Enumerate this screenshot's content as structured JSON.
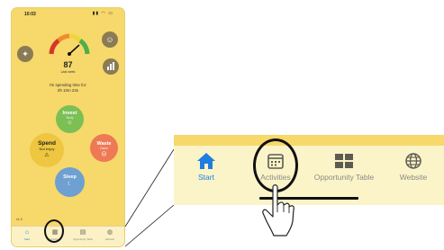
{
  "phone": {
    "status": {
      "time": "10:03",
      "icons": "▮▮ ◠ ▭"
    },
    "top_left_icon": "handshake-icon",
    "top_right_icon": "smiley-icon",
    "stats_icon": "bar-chart-icon",
    "score": "87",
    "score_label": "Last week",
    "spending_line1": "I'm spending time for:",
    "spending_line2": "0h 10m 23s",
    "bubbles": {
      "invest": {
        "title": "Invest",
        "sub": "Study",
        "icon": "☺"
      },
      "spend": {
        "title": "Spend",
        "sub": "Not enjoy",
        "icon": "⚠"
      },
      "waste": {
        "title": "Waste",
        "sub": "Game",
        "icon": "☹"
      },
      "sleep": {
        "title": "Sleep",
        "icon": "☾"
      }
    },
    "version": "v1.3",
    "tabs": [
      {
        "label": "Start",
        "icon": "⌂"
      },
      {
        "label": "Activities",
        "icon": "▦"
      },
      {
        "label": "Opportunity Table",
        "icon": "▤"
      },
      {
        "label": "Website",
        "icon": "◍"
      }
    ]
  },
  "zoom": {
    "tabs": [
      {
        "label": "Start",
        "icon": "house-icon"
      },
      {
        "label": "Activities",
        "icon": "calendar-icon"
      },
      {
        "label": "Opportunity Table",
        "icon": "table-icon"
      },
      {
        "label": "Website",
        "icon": "globe-icon"
      }
    ]
  },
  "colors": {
    "background": "#f6d86b",
    "tabbar": "#fbf4c8",
    "accent": "#1f7ee0",
    "invest": "#7cbf55",
    "spend": "#eec63f",
    "waste": "#ee7a55",
    "sleep": "#6ea0d2",
    "highlight": "#111111"
  }
}
